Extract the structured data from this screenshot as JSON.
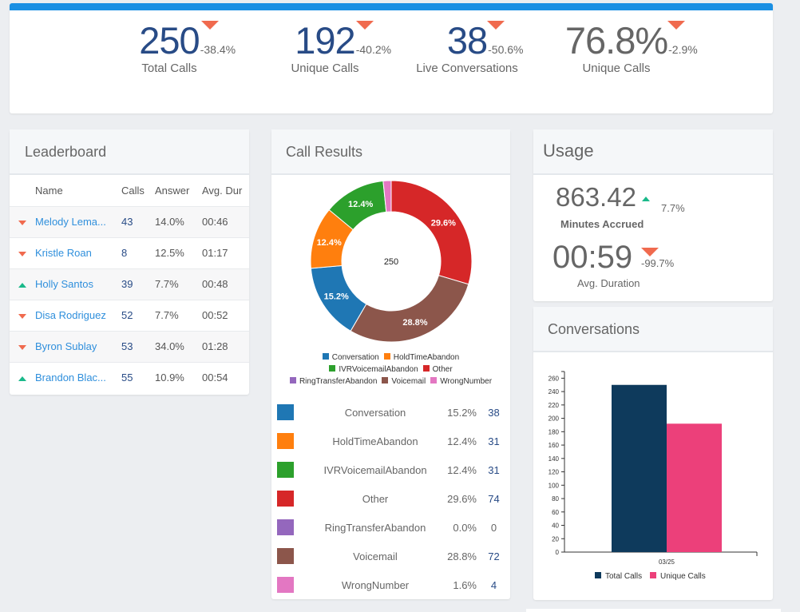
{
  "kpis": [
    {
      "value": "250",
      "delta": "-38.4%",
      "direction": "down",
      "label": "Total Calls"
    },
    {
      "value": "192",
      "delta": "-40.2%",
      "direction": "down",
      "label": "Unique Calls"
    },
    {
      "value": "38",
      "delta": "-50.6%",
      "direction": "down",
      "label": "Live Conversations"
    },
    {
      "value": "76.8%",
      "delta": "-2.9%",
      "direction": "down",
      "label": "Unique Calls"
    }
  ],
  "leaderboard": {
    "title": "Leaderboard",
    "columns": [
      "Name",
      "Calls",
      "Answer",
      "Avg. Dur"
    ],
    "rows": [
      {
        "trend": "down",
        "name": "Melody Lema...",
        "calls": "43",
        "answer": "14.0%",
        "avg_dur": "00:46"
      },
      {
        "trend": "down",
        "name": "Kristle Roan",
        "calls": "8",
        "answer": "12.5%",
        "avg_dur": "01:17"
      },
      {
        "trend": "up",
        "name": "Holly Santos",
        "calls": "39",
        "answer": "7.7%",
        "avg_dur": "00:48"
      },
      {
        "trend": "down",
        "name": "Disa Rodriguez",
        "calls": "52",
        "answer": "7.7%",
        "avg_dur": "00:52"
      },
      {
        "trend": "down",
        "name": "Byron Sublay",
        "calls": "53",
        "answer": "34.0%",
        "avg_dur": "01:28"
      },
      {
        "trend": "up",
        "name": "Brandon Blac...",
        "calls": "55",
        "answer": "10.9%",
        "avg_dur": "00:54"
      }
    ]
  },
  "call_results": {
    "title": "Call Results",
    "center_label": "250",
    "items": [
      {
        "name": "Conversation",
        "pct": "15.2%",
        "count": "38",
        "color": "#1f77b4"
      },
      {
        "name": "HoldTimeAbandon",
        "pct": "12.4%",
        "count": "31",
        "color": "#ff7f0e"
      },
      {
        "name": "IVRVoicemailAbandon",
        "pct": "12.4%",
        "count": "31",
        "color": "#2ca02c"
      },
      {
        "name": "Other",
        "pct": "29.6%",
        "count": "74",
        "color": "#d62728"
      },
      {
        "name": "RingTransferAbandon",
        "pct": "0.0%",
        "count": "0",
        "color": "#9467bd"
      },
      {
        "name": "Voicemail",
        "pct": "28.8%",
        "count": "72",
        "color": "#8c564b"
      },
      {
        "name": "WrongNumber",
        "pct": "1.6%",
        "count": "4",
        "color": "#e377c2"
      }
    ]
  },
  "usage": {
    "title": "Usage",
    "minutes_value": "863.42",
    "minutes_delta": "7.7%",
    "minutes_direction": "up",
    "minutes_label": "Minutes Accrued",
    "duration_value": "00:59",
    "duration_delta": "-99.7%",
    "duration_direction": "down",
    "duration_label": "Avg. Duration"
  },
  "conversations": {
    "title": "Conversations"
  },
  "colors": {
    "accent": "#1a8fe3",
    "down": "#f06a4e",
    "up": "#1ab98a",
    "kpi_blue": "#284b86",
    "link": "#2f8fdc"
  },
  "chart_data": [
    {
      "type": "pie",
      "title": "Call Results",
      "center_label": "250",
      "categories": [
        "Conversation",
        "HoldTimeAbandon",
        "IVRVoicemailAbandon",
        "Other",
        "RingTransferAbandon",
        "Voicemail",
        "WrongNumber"
      ],
      "values": [
        38,
        31,
        31,
        74,
        0,
        72,
        4
      ],
      "data_labels": [
        "15.2%",
        "12.4%",
        "12.4%",
        "29.6%",
        "",
        "28.8%",
        ""
      ],
      "draw_order": [
        "Other",
        "Voicemail",
        "Conversation",
        "HoldTimeAbandon",
        "IVRVoicemailAbandon",
        "RingTransferAbandon",
        "WrongNumber"
      ],
      "legend": "bottom"
    },
    {
      "type": "bar",
      "title": "Conversations",
      "categories": [
        "03/25"
      ],
      "series": [
        {
          "name": "Total Calls",
          "values": [
            250
          ],
          "color": "#0e3a5c"
        },
        {
          "name": "Unique Calls",
          "values": [
            192
          ],
          "color": "#ec407a"
        }
      ],
      "yticks": [
        0,
        20,
        40,
        60,
        80,
        100,
        120,
        140,
        160,
        180,
        200,
        220,
        240,
        260
      ],
      "ylim": [
        0,
        270
      ],
      "xlabel": "",
      "ylabel": "",
      "legend": "bottom"
    }
  ]
}
